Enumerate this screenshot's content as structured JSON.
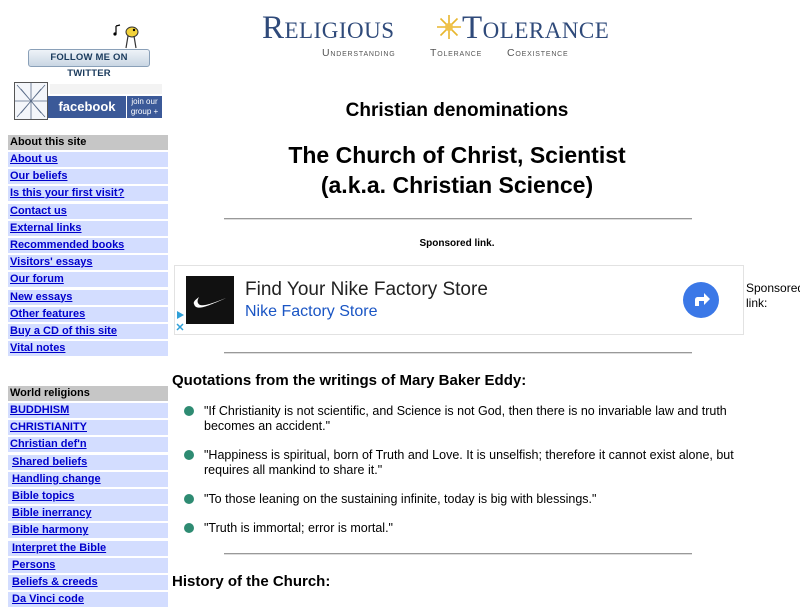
{
  "social": {
    "twitter_label": "FOLLOW ME ON TWITTER",
    "facebook_label": "facebook",
    "facebook_join": "join our group +"
  },
  "logo": {
    "word1": "Religious",
    "word2": "Tolerance",
    "tagline": [
      "Understanding",
      "Tolerance",
      "Coexistence"
    ]
  },
  "sidebar": {
    "about": {
      "header": "About this site",
      "items": [
        "About us",
        "Our beliefs",
        "Is this your first visit?",
        "Contact us",
        "External links",
        "Recommended books",
        "Visitors' essays",
        "Our forum",
        "New essays",
        "Other features",
        "Buy a CD of this site",
        "Vital notes"
      ]
    },
    "religions": {
      "header": "World religions",
      "items": [
        "BUDDHISM",
        "CHRISTIANITY",
        "Christian def'n",
        "Shared beliefs",
        "Handling change",
        "Bible topics",
        "Bible inerrancy",
        "Bible harmony",
        "Interpret the Bible",
        "Persons",
        "Beliefs & creeds",
        "Da Vinci code"
      ]
    }
  },
  "main": {
    "section_title": "Christian denominations",
    "title_line1": "The Church of Christ, Scientist",
    "title_line2": "(a.k.a. Christian Science)",
    "sponsored": "Sponsored link.",
    "side_sponsored": "Sponsored link:",
    "quotes_heading": "Quotations from the writings of Mary Baker Eddy:",
    "quotes": [
      "\"If Christianity is not scientific, and Science is not God, then there is no invariable law and truth becomes an accident.\"",
      "\"Happiness is spiritual, born of Truth and Love. It is unselfish; therefore it cannot exist alone, but requires all mankind to share it.\"",
      "\"To those leaning on the sustaining infinite, today is big with blessings.\"",
      "\"Truth is immortal; error is mortal.\""
    ],
    "history_heading": "History of the Church:"
  },
  "ad": {
    "headline": "Find Your Nike Factory Store",
    "subline": "Nike Factory Store",
    "colors": {
      "brand_bg": "#111111",
      "link": "#1a55c4",
      "button": "#3b78e7"
    }
  },
  "colors": {
    "nav_item_bg": "#d3ddff",
    "nav_header_bg": "#c6c6c6",
    "link": "#0000cc",
    "bullet": "#2e8b72",
    "logo_text": "#2f4a7a"
  }
}
